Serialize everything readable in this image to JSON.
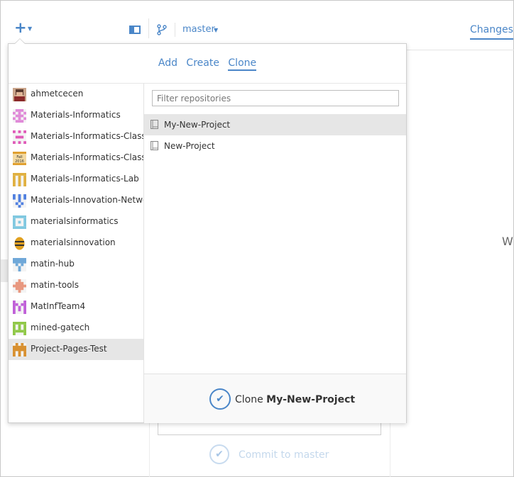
{
  "toolbar": {
    "add_icon": "plus-icon",
    "panel_icon": "sidebar-toggle-icon",
    "branch_icon": "git-branch-icon",
    "branch": "master",
    "changes_tab": "Changes"
  },
  "background": {
    "welcome_partial": "W",
    "commit_button": "Commit to master"
  },
  "popover": {
    "tabs": [
      "Add",
      "Create",
      "Clone"
    ],
    "active_tab": "Clone",
    "filter_placeholder": "Filter repositories",
    "accounts": [
      {
        "name": "ahmetcecen",
        "avatar": "photo-avatar",
        "color": "#8a5a48"
      },
      {
        "name": "Materials-Informatics",
        "avatar": "identicon-avatar",
        "color": "#e08ad8"
      },
      {
        "name": "Materials-Informatics-Class",
        "avatar": "identicon-avatar",
        "color": "#e05ab8"
      },
      {
        "name": "Materials-Informatics-Class-F",
        "avatar": "fall-2016-avatar",
        "color": "#e0a030"
      },
      {
        "name": "Materials-Informatics-Lab",
        "avatar": "identicon-avatar",
        "color": "#e0b040"
      },
      {
        "name": "Materials-Innovation-Networ",
        "avatar": "identicon-avatar",
        "color": "#5080e0"
      },
      {
        "name": "materialsinformatics",
        "avatar": "identicon-avatar",
        "color": "#80c8e0"
      },
      {
        "name": "materialsinnovation",
        "avatar": "identicon-avatar",
        "color": "#e0a020"
      },
      {
        "name": "matin-hub",
        "avatar": "identicon-avatar",
        "color": "#70a8d8"
      },
      {
        "name": "matin-tools",
        "avatar": "identicon-avatar",
        "color": "#e89880"
      },
      {
        "name": "MatInfTeam4",
        "avatar": "identicon-avatar",
        "color": "#c060d8"
      },
      {
        "name": "mined-gatech",
        "avatar": "identicon-avatar",
        "color": "#90c848"
      },
      {
        "name": "Project-Pages-Test",
        "avatar": "identicon-avatar",
        "color": "#d89030"
      }
    ],
    "selected_account": "Project-Pages-Test",
    "repositories": [
      {
        "name": "My-New-Project",
        "icon": "repo-book-icon"
      },
      {
        "name": "New-Project",
        "icon": "repo-book-icon"
      }
    ],
    "selected_repository": "My-New-Project",
    "clone_prefix": "Clone",
    "clone_target": "My-New-Project"
  }
}
